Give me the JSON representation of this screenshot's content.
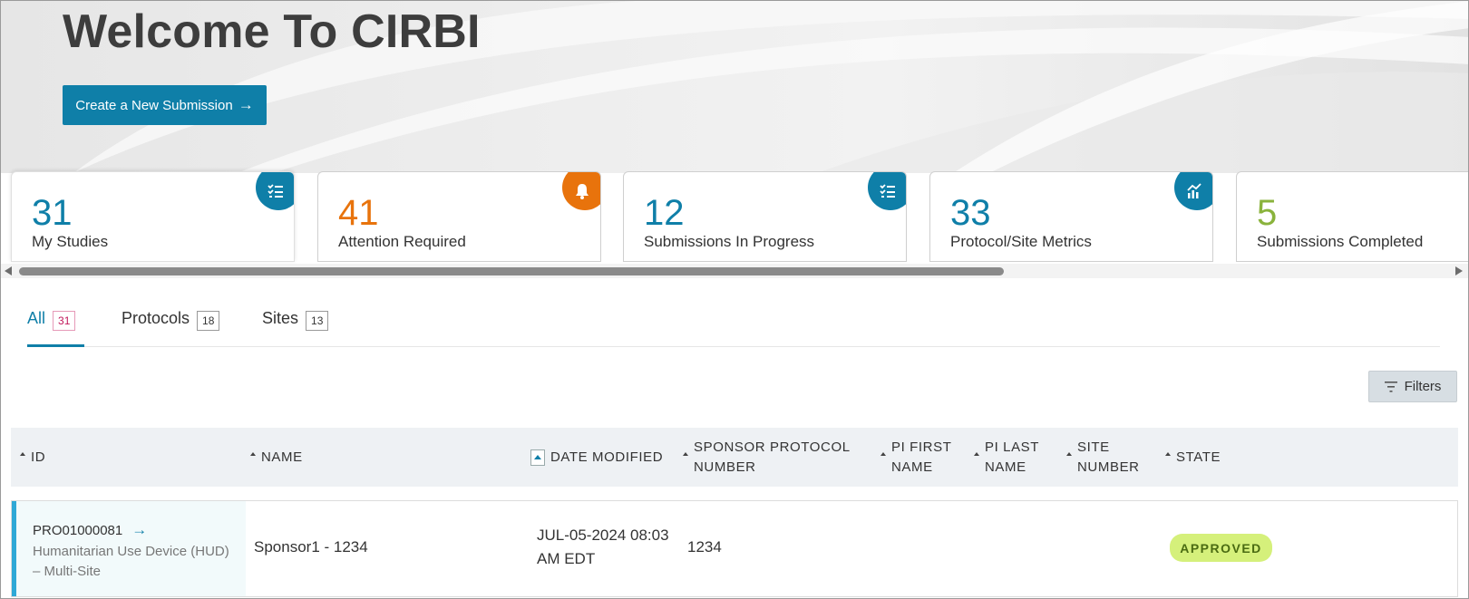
{
  "hero": {
    "title": "Welcome To CIRBI",
    "new_submission_label": "Create a New Submission",
    "new_submission_icon": "arrow-right-icon"
  },
  "cards": [
    {
      "count": "31",
      "label": "My Studies",
      "color": "#0f7fa8",
      "icon": "checklist-icon",
      "badge_color": "#0f7fa8"
    },
    {
      "count": "41",
      "label": "Attention Required",
      "color": "#e8730c",
      "icon": "bell-icon",
      "badge_color": "#e8730c"
    },
    {
      "count": "12",
      "label": "Submissions In Progress",
      "color": "#0f7fa8",
      "icon": "checklist-icon",
      "badge_color": "#0f7fa8"
    },
    {
      "count": "33",
      "label": "Protocol/Site Metrics",
      "color": "#0f7fa8",
      "icon": "chart-icon",
      "badge_color": "#0f7fa8"
    },
    {
      "count": "5",
      "label": "Submissions Completed",
      "color": "#8ab33c",
      "icon": "",
      "badge_color": ""
    }
  ],
  "tabs": [
    {
      "label": "All",
      "count": "31"
    },
    {
      "label": "Protocols",
      "count": "18"
    },
    {
      "label": "Sites",
      "count": "13"
    }
  ],
  "filters_label": "Filters",
  "table": {
    "columns": {
      "id": "ID",
      "name": "NAME",
      "date_modified": "DATE MODIFIED",
      "sponsor_protocol_1": "SPONSOR PROTOCOL",
      "sponsor_protocol_2": "NUMBER",
      "pi_first_1": "PI FIRST",
      "pi_first_2": "NAME",
      "pi_last_1": "PI LAST",
      "pi_last_2": "NAME",
      "site_number_1": "SITE",
      "site_number_2": "NUMBER",
      "state": "STATE"
    },
    "rows": [
      {
        "id": "PRO01000081",
        "type_line1": "Humanitarian Use Device (HUD)",
        "type_line2": "– Multi-Site",
        "name": "Sponsor1 - 1234",
        "date_line1": "JUL-05-2024 08:03",
        "date_line2": "AM EDT",
        "sponsor_protocol_number": "1234",
        "state": "APPROVED"
      }
    ]
  },
  "colors": {
    "accent": "#0f7fa8",
    "attention": "#e8730c",
    "completed": "#8ab33c",
    "approved_bg": "#d5f07b"
  }
}
